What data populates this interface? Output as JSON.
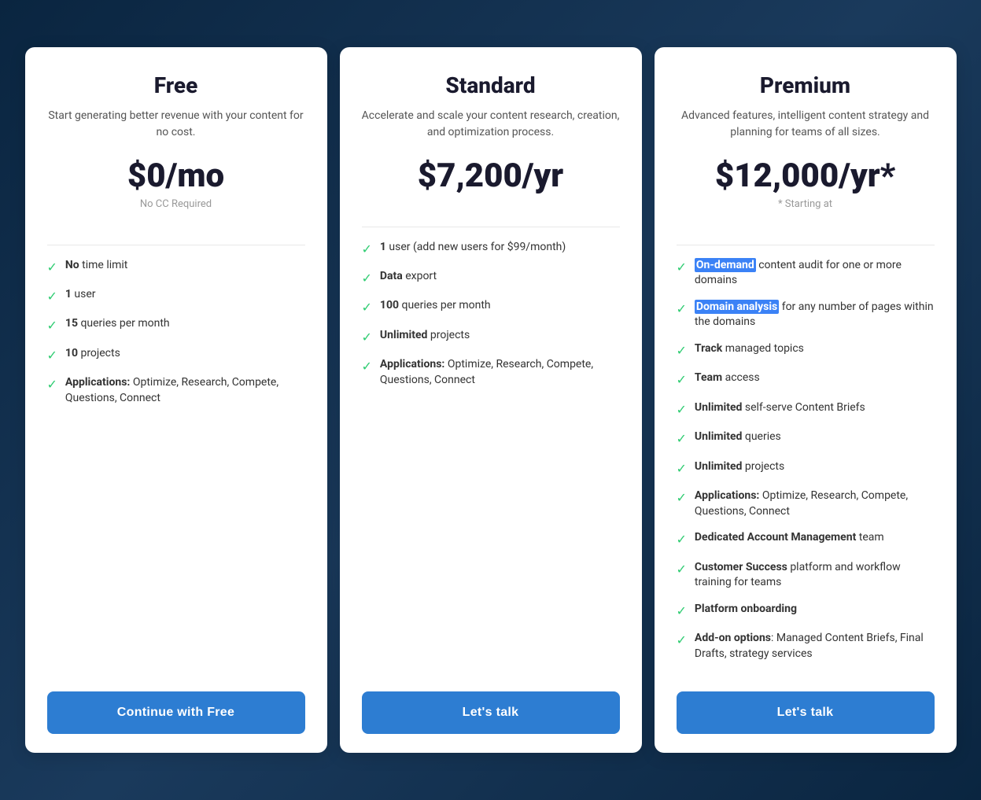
{
  "plans": [
    {
      "id": "free",
      "name": "Free",
      "description": "Start generating better revenue with your content for no cost.",
      "price": "$0/mo",
      "price_sub": "No CC Required",
      "cta": "Continue with Free",
      "features": [
        {
          "bold": "No",
          "rest": " time limit"
        },
        {
          "bold": "1",
          "rest": " user"
        },
        {
          "bold": "15",
          "rest": " queries per month"
        },
        {
          "bold": "10",
          "rest": " projects"
        },
        {
          "bold": "Applications:",
          "rest": " Optimize, Research, Compete, Questions, Connect"
        }
      ]
    },
    {
      "id": "standard",
      "name": "Standard",
      "description": "Accelerate and scale your content research, creation, and optimization process.",
      "price": "$7,200/yr",
      "price_sub": "",
      "cta": "Let's talk",
      "features": [
        {
          "bold": "1",
          "rest": " user (add new users for $99/month)"
        },
        {
          "bold": "Data",
          "rest": " export"
        },
        {
          "bold": "100",
          "rest": " queries per month"
        },
        {
          "bold": "Unlimited",
          "rest": " projects"
        },
        {
          "bold": "Applications:",
          "rest": " Optimize, Research, Compete, Questions, Connect"
        }
      ]
    },
    {
      "id": "premium",
      "name": "Premium",
      "description": "Advanced features, intelligent content strategy and planning for teams of all sizes.",
      "price": "$12,000/yr*",
      "price_sub": "* Starting at",
      "cta": "Let's talk",
      "features": [
        {
          "bold": "On-demand",
          "rest": " content audit for one or more domains",
          "highlight_bold": true
        },
        {
          "bold": "Domain analysis",
          "rest": " for any number of pages within the domains",
          "highlight_bold": true
        },
        {
          "bold": "Track",
          "rest": " managed topics"
        },
        {
          "bold": "Team",
          "rest": " access"
        },
        {
          "bold": "Unlimited",
          "rest": " self-serve Content Briefs"
        },
        {
          "bold": "Unlimited",
          "rest": " queries"
        },
        {
          "bold": "Unlimited",
          "rest": " projects"
        },
        {
          "bold": "Applications:",
          "rest": " Optimize, Research, Compete, Questions, Connect"
        },
        {
          "bold": "Dedicated Account Management",
          "rest": " team"
        },
        {
          "bold": "Customer Success",
          "rest": " platform and workflow training for teams"
        },
        {
          "bold": "Platform onboarding",
          "rest": ""
        },
        {
          "bold": "Add-on options",
          "rest": ": Managed Content Briefs, Final Drafts, strategy services"
        }
      ]
    }
  ],
  "icons": {
    "check": "✓"
  }
}
